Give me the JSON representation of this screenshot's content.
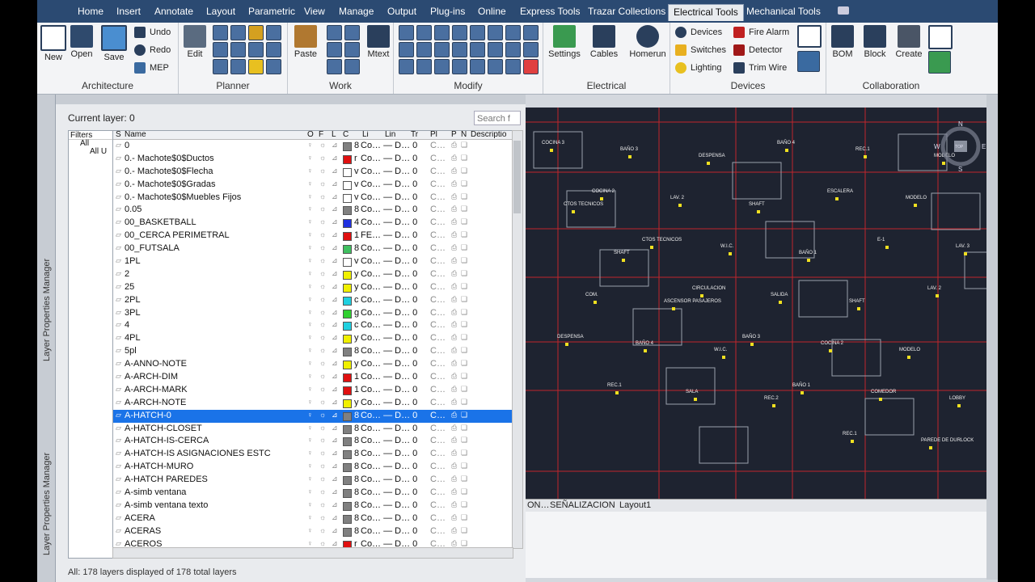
{
  "tabs": [
    "Home",
    "Insert",
    "Annotate",
    "Layout",
    "Parametric",
    "View",
    "Manage",
    "Output",
    "Plug-ins",
    "Online",
    "Express Tools",
    "Trazar Collections",
    "Electrical Tools",
    "Mechanical Tools"
  ],
  "active_tab": "Electrical Tools",
  "ribbon": {
    "architecture": {
      "title": "Architecture",
      "new": "New",
      "open": "Open",
      "save": "Save",
      "undo": "Undo",
      "redo": "Redo",
      "mep": "MEP"
    },
    "planner": {
      "title": "Planner",
      "edit": "Edit"
    },
    "work": {
      "title": "Work",
      "paste": "Paste",
      "mtext": "Mtext"
    },
    "modify": {
      "title": "Modify"
    },
    "electrical": {
      "title": "Electrical",
      "settings": "Settings",
      "cables": "Cables",
      "homerun": "Homerun"
    },
    "devices": {
      "title": "Devices",
      "devices": "Devices",
      "switches": "Switches",
      "lighting": "Lighting",
      "fire_alarm": "Fire Alarm",
      "detector": "Detector",
      "trim_wire": "Trim Wire"
    },
    "collaboration": {
      "title": "Collaboration",
      "bom": "BOM",
      "block": "Block",
      "create": "Create"
    }
  },
  "palette": {
    "side_label": "Layer Properties Manager",
    "current_layer": "Current layer: 0",
    "search_placeholder": "Search f",
    "filters_header": "Filters",
    "filters": [
      "All",
      "All U"
    ],
    "columns": [
      "S",
      "Name",
      "O",
      "F",
      "L",
      "C",
      "Li",
      "Lin",
      "Tr",
      "Pl",
      "P",
      "N",
      "Descriptio"
    ],
    "status": "All: 178 layers displayed of 178 total layers",
    "layers": [
      {
        "name": "0",
        "color_label": "8",
        "color": "#808080",
        "rest": "Co… — D… 0"
      },
      {
        "name": "0.- Machote$0$Ductos",
        "color_label": "r",
        "color": "#e01010",
        "rest": "Co… — D… 0"
      },
      {
        "name": "0.- Machote$0$Flecha",
        "color_label": "v",
        "color": "#ffffff",
        "rest": "Co… — D… 0"
      },
      {
        "name": "0.- Machote$0$Gradas",
        "color_label": "v",
        "color": "#ffffff",
        "rest": "Co… — D… 0"
      },
      {
        "name": "0.- Machote$0$Muebles Fijos",
        "color_label": "v",
        "color": "#ffffff",
        "rest": "Co… — D… 0"
      },
      {
        "name": "0.05",
        "color_label": "8",
        "color": "#808080",
        "rest": "Co… — D… 0"
      },
      {
        "name": "00_BASKETBALL",
        "color_label": "4",
        "color": "#2030e0",
        "rest": "Co… — D… 0"
      },
      {
        "name": "00_CERCA PERIMETRAL",
        "color_label": "1",
        "color": "#e01010",
        "rest": "FE… — D… 0"
      },
      {
        "name": "00_FUTSALA",
        "color_label": "8",
        "color": "#40c060",
        "rest": "Co… — D… 0"
      },
      {
        "name": "1PL",
        "color_label": "v",
        "color": "#ffffff",
        "rest": "Co… — D… 0"
      },
      {
        "name": "2",
        "color_label": "y",
        "color": "#f0f000",
        "rest": "Co… — D… 0"
      },
      {
        "name": "25",
        "color_label": "y",
        "color": "#f0f000",
        "rest": "Co… — D… 0"
      },
      {
        "name": "2PL",
        "color_label": "c",
        "color": "#20d0e0",
        "rest": "Co… — D… 0"
      },
      {
        "name": "3PL",
        "color_label": "g",
        "color": "#30d030",
        "rest": "Co… — D… 0"
      },
      {
        "name": "4",
        "color_label": "c",
        "color": "#20d0e0",
        "rest": "Co… — D… 0"
      },
      {
        "name": "4PL",
        "color_label": "y",
        "color": "#f0f000",
        "rest": "Co… — D… 0"
      },
      {
        "name": "5pl",
        "color_label": "8",
        "color": "#808080",
        "rest": "Co… — D… 0"
      },
      {
        "name": "A-ANNO-NOTE",
        "color_label": "y",
        "color": "#f0f000",
        "rest": "Co… — D… 0"
      },
      {
        "name": "A-ARCH-DIM",
        "color_label": "1",
        "color": "#e01010",
        "rest": "Co… — D… 0"
      },
      {
        "name": "A-ARCH-MARK",
        "color_label": "1",
        "color": "#e01010",
        "rest": "Co… — D… 0"
      },
      {
        "name": "A-ARCH-NOTE",
        "color_label": "y",
        "color": "#f0f000",
        "rest": "Co… — D… 0"
      },
      {
        "name": "A-HATCH-0",
        "color_label": "8",
        "color": "#808080",
        "rest": "Co… — D… 0",
        "selected": true
      },
      {
        "name": "A-HATCH-CLOSET",
        "color_label": "8",
        "color": "#808080",
        "rest": "Co… — D… 0"
      },
      {
        "name": "A-HATCH-IS-CERCA",
        "color_label": "8",
        "color": "#808080",
        "rest": "Co… — D… 0"
      },
      {
        "name": "A-HATCH-IS ASIGNACIONES ESTC",
        "color_label": "8",
        "color": "#808080",
        "rest": "Co… — D… 0"
      },
      {
        "name": "A-HATCH-MURO",
        "color_label": "8",
        "color": "#808080",
        "rest": "Co… — D… 0"
      },
      {
        "name": "A-HATCH PAREDES",
        "color_label": "8",
        "color": "#808080",
        "rest": "Co… — D… 0"
      },
      {
        "name": "A-simb ventana",
        "color_label": "8",
        "color": "#808080",
        "rest": "Co… — D… 0"
      },
      {
        "name": "A-simb ventana texto",
        "color_label": "8",
        "color": "#808080",
        "rest": "Co… — D… 0"
      },
      {
        "name": "ACERA",
        "color_label": "8",
        "color": "#808080",
        "rest": "Co… — D… 0"
      },
      {
        "name": "ACERAS",
        "color_label": "8",
        "color": "#808080",
        "rest": "Co… — D… 0"
      },
      {
        "name": "ACEROS",
        "color_label": "r",
        "color": "#e01010",
        "rest": "Co… — D… 0"
      }
    ]
  },
  "drawing": {
    "labels": [
      "COCINA 3",
      "BAÑO 3",
      "DESPENSA",
      "BAÑO 4",
      "REC.1",
      "MODELO",
      "COCINA 2",
      "LAV. 2",
      "SHAFT",
      "ESCALERA",
      "MODELO",
      "CTOS TECNICOS",
      "CTOS TECNICOS",
      "W.I.C.",
      "BAÑO 1",
      "E-1",
      "LAV. 3",
      "SHAFT",
      "CIRCULACION",
      "SALIDA",
      "SHAFT",
      "LAV. 2",
      "COM.",
      "ASCENSOR PASAJEROS",
      "BAÑO 3",
      "COCINA 2",
      "MODELO",
      "DESPENSA",
      "BAÑO 4",
      "W.I.C.",
      "BAÑO 1",
      "COMEDOR",
      "LOBBY",
      "REC.1",
      "SALA",
      "REC.2",
      "REC.1",
      "PAREDE DE DURLOCK"
    ],
    "tabs": [
      "ON…",
      "SEÑALIZACION",
      "Layout1"
    ],
    "compass": {
      "n": "N",
      "s": "S",
      "e": "E",
      "w": "W",
      "top": "TOP"
    }
  }
}
